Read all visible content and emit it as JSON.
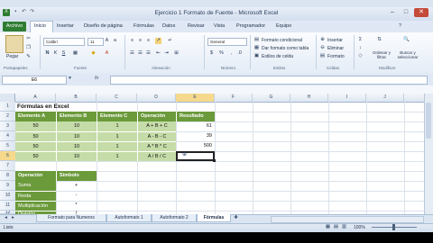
{
  "window": {
    "title": "Ejercicio 1 Formato de Fuente - Microsoft Excel",
    "controls": {
      "minimize": "–",
      "maximize": "□",
      "close": "✕"
    }
  },
  "ribbon_tabs": [
    "Archivo",
    "Inicio",
    "Insertar",
    "Diseño de página",
    "Fórmulas",
    "Datos",
    "Revisar",
    "Vista",
    "Programador",
    "Equipo"
  ],
  "ribbon": {
    "clipboard": {
      "label": "Portapapeles",
      "paste": "Pegar"
    },
    "font": {
      "label": "Fuente",
      "name": "Calibri",
      "size": "11",
      "bold": "N",
      "italic": "K",
      "underline": "S"
    },
    "alignment": {
      "label": "Alineación"
    },
    "number": {
      "label": "Número",
      "format": "General",
      "currency": "$",
      "percent": "%"
    },
    "styles": {
      "label": "Estilos",
      "conditional": "Formato condicional",
      "table": "Dar formato como tabla",
      "cell": "Estilos de celda"
    },
    "cells": {
      "label": "Celdas",
      "insert": "Insertar",
      "delete": "Eliminar",
      "format": "Formato"
    },
    "editing": {
      "label": "Modificar",
      "sort": "Ordenar y filtrar",
      "find": "Buscar y seleccionar"
    }
  },
  "formula_bar": {
    "name_box": "E6",
    "fx": "fx",
    "value": ""
  },
  "columns": [
    "A",
    "B",
    "C",
    "D",
    "E",
    "F",
    "G",
    "H",
    "I",
    "J"
  ],
  "rows": [
    "1",
    "2",
    "3",
    "4",
    "5",
    "6",
    "7",
    "8",
    "9",
    "10",
    "11",
    "12"
  ],
  "sheet": {
    "title": "Fórmulas en Excel",
    "table_headers": [
      "Elemento A",
      "Elemento B",
      "Elemento C",
      "Operación",
      "Resultado"
    ],
    "table_rows": [
      {
        "a": "50",
        "b": "10",
        "c": "1",
        "op": "A + B + C",
        "res": "61"
      },
      {
        "a": "50",
        "b": "10",
        "c": "1",
        "op": "A - B - C",
        "res": "39"
      },
      {
        "a": "50",
        "b": "10",
        "c": "1",
        "op": "A * B * C",
        "res": "500"
      },
      {
        "a": "50",
        "b": "10",
        "c": "1",
        "op": "A / B / C",
        "res": ""
      }
    ],
    "legend_headers": [
      "Operación",
      "Símbolo"
    ],
    "legend_rows": [
      {
        "name": "Suma",
        "symbol": "+"
      },
      {
        "name": "Resta",
        "symbol": "-"
      },
      {
        "name": "Multiplicación",
        "symbol": "*"
      },
      {
        "name": "División",
        "symbol": "/"
      }
    ]
  },
  "sheet_tabs": [
    "Formato para Numeros",
    "Autoformato 1",
    "Autoformato 2",
    "Fórmulas"
  ],
  "status": {
    "ready": "Listo",
    "zoom": "100%"
  }
}
